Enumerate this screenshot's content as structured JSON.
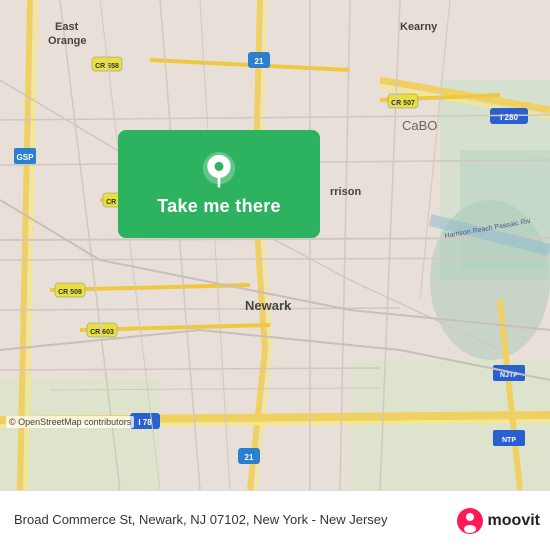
{
  "map": {
    "background_color": "#e8e0d8",
    "overlay_button": {
      "label": "Take me there",
      "background": "#2db360"
    },
    "location_label": "CaBO"
  },
  "info_bar": {
    "address": "Broad Commerce St, Newark, NJ 07102, New York -\nNew Jersey",
    "osm_credit": "© OpenStreetMap contributors",
    "moovit_label": "moovit"
  },
  "icons": {
    "location_pin": "📍",
    "moovit_icon": "🚌"
  }
}
